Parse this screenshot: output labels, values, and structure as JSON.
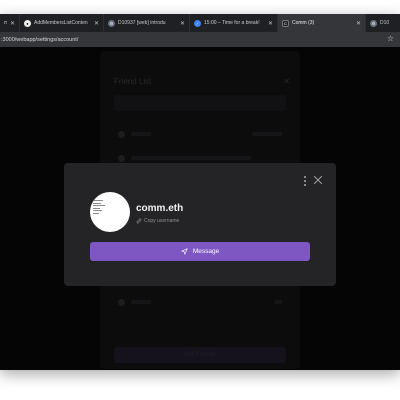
{
  "browser": {
    "tabs": [
      {
        "title": "m",
        "icon": "blank-page-icon",
        "active": false
      },
      {
        "title": "AddMembersListConten",
        "icon": "github-icon",
        "active": false
      },
      {
        "title": "D10937 [web] introdu",
        "icon": "phabricator-icon",
        "active": false
      },
      {
        "title": "15:00 – Time for a break!",
        "icon": "timer-icon",
        "active": false
      },
      {
        "title": "Comm (3)",
        "icon": "comm-icon",
        "favicon_letter": "C",
        "active": true
      },
      {
        "title": "D10",
        "icon": "phabricator-icon",
        "active": false
      }
    ],
    "url": ":3000/webapp/settings/account/",
    "colors": {
      "tabstrip": "#1f2023",
      "active_tab": "#35363a"
    }
  },
  "background_panel": {
    "title": "Friend List",
    "button_label": "Add Friends"
  },
  "modal": {
    "username": "comm.eth",
    "copy_label": "Copy username",
    "message_button_label": "Message",
    "colors": {
      "accent": "#7e57c2",
      "background": "#242426"
    }
  }
}
